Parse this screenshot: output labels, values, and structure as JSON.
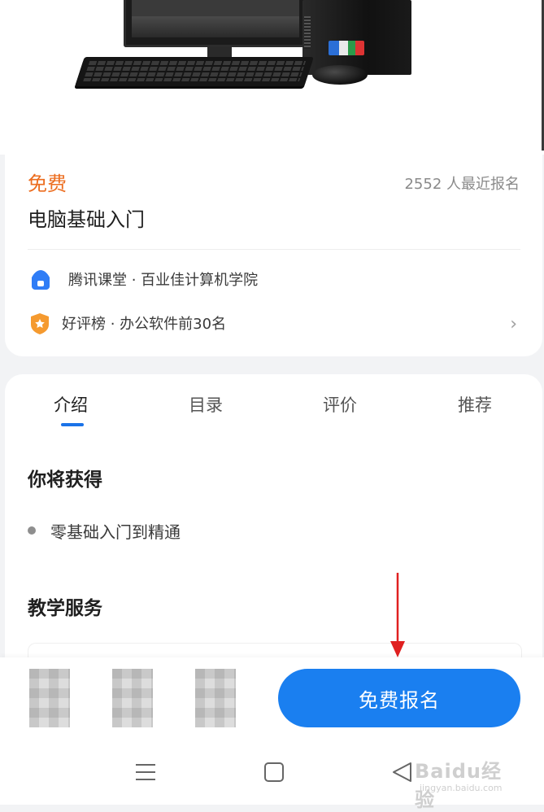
{
  "hero": {
    "image_alt": "desktop-computer-illustration"
  },
  "course": {
    "price": "免费",
    "enroll_count": "2552 人最近报名",
    "title": "电脑基础入门",
    "org": "腾讯课堂 · 百业佳计算机学院",
    "rank": "好评榜 · 办公软件前30名",
    "chevron": "›"
  },
  "tabs": [
    {
      "label": "介绍",
      "active": true
    },
    {
      "label": "目录",
      "active": false
    },
    {
      "label": "评价",
      "active": false
    },
    {
      "label": "推荐",
      "active": false
    }
  ],
  "sections": {
    "gain_title": "你将获得",
    "gain_items": [
      "零基础入门到精通"
    ],
    "service_title": "教学服务"
  },
  "action_bar": {
    "enroll_button": "免费报名"
  },
  "nav_bar": {
    "menu_icon": "menu-icon",
    "home_icon": "home-icon",
    "back_icon": "back-icon"
  },
  "watermark": {
    "main": "Baidu经验",
    "sub": "jingyan.baidu.com"
  },
  "colors": {
    "price_orange": "#ec6d1f",
    "accent_blue": "#1a7ff0",
    "tab_underline": "#1a73e8",
    "annotation_red": "#e02020"
  }
}
